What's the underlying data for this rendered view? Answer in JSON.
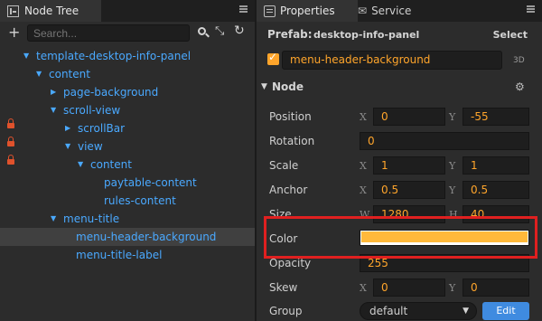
{
  "left_panel": {
    "tab_label": "Node Tree",
    "search_placeholder": "Search...",
    "tree": [
      {
        "label": "template-desktop-info-panel",
        "expanded": true
      },
      {
        "label": "content",
        "expanded": true
      },
      {
        "label": "page-background",
        "expanded": false
      },
      {
        "label": "scroll-view",
        "expanded": true
      },
      {
        "label": "scrollBar",
        "expanded": false,
        "locked": true
      },
      {
        "label": "view",
        "expanded": true,
        "locked": true
      },
      {
        "label": "content",
        "expanded": true,
        "locked": true
      },
      {
        "label": "paytable-content"
      },
      {
        "label": "rules-content"
      },
      {
        "label": "menu-title",
        "expanded": true
      },
      {
        "label": "menu-header-background",
        "selected": true
      },
      {
        "label": "menu-title-label"
      }
    ]
  },
  "right_panel": {
    "tab_properties": "Properties",
    "tab_service": "Service",
    "prefab_label": "Prefab:",
    "prefab_name": "desktop-info-panel",
    "select_label": "Select",
    "node_name": "menu-header-background",
    "badge_3d": "3D",
    "section_title": "Node",
    "props": {
      "position": {
        "label": "Position",
        "x": "0",
        "y": "-55"
      },
      "rotation": {
        "label": "Rotation",
        "value": "0"
      },
      "scale": {
        "label": "Scale",
        "x": "1",
        "y": "1"
      },
      "anchor": {
        "label": "Anchor",
        "x": "0.5",
        "y": "0.5"
      },
      "size": {
        "label": "Size",
        "w": "1280",
        "h": "40",
        "w_axis": "W",
        "h_axis": "H"
      },
      "color": {
        "label": "Color",
        "hex": "#ffb93a"
      },
      "opacity": {
        "label": "Opacity",
        "value": "255"
      },
      "skew": {
        "label": "Skew",
        "x": "0",
        "y": "0"
      },
      "group": {
        "label": "Group",
        "value": "default",
        "edit_label": "Edit"
      }
    },
    "axis_x": "X",
    "axis_y": "Y"
  },
  "highlight_color": "#e02020"
}
